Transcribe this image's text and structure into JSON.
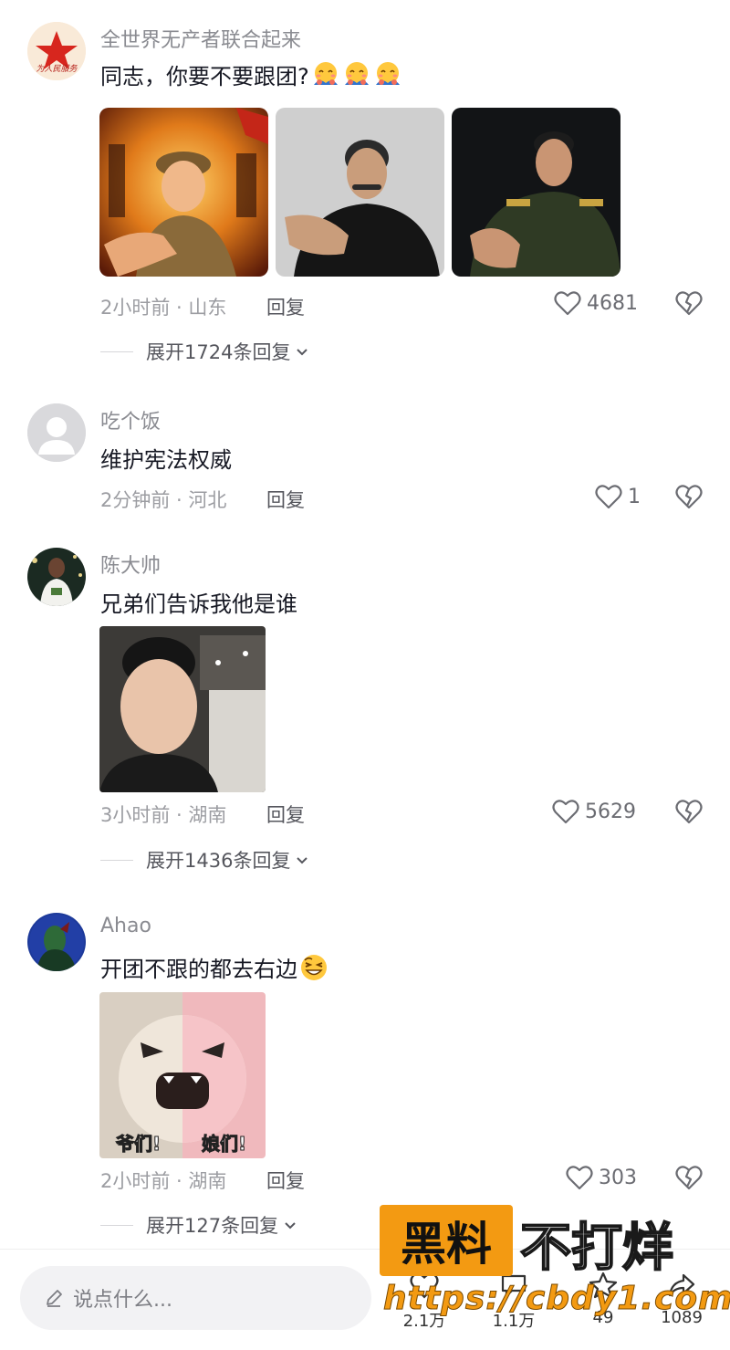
{
  "comments": [
    {
      "username": "全世界无产者联合起来",
      "text": "同志，你要不要跟团?",
      "avatar_caption": "为人民服务",
      "time_location": "2小时前 · 山东",
      "reply_label": "回复",
      "likes": "4681",
      "expand_label": "展开1724条回复",
      "images": [
        "revolutionary-soldier-reaching-hand",
        "man-in-black-robe-reaching-hand",
        "military-officer-reaching-hand"
      ]
    },
    {
      "username": "吃个饭",
      "text": "维护宪法权威",
      "time_location": "2分钟前 · 河北",
      "reply_label": "回复",
      "likes": "1"
    },
    {
      "username": "陈大帅",
      "text": "兄弟们告诉我他是谁",
      "time_location": "3小时前 · 湖南",
      "reply_label": "回复",
      "likes": "5629",
      "expand_label": "展开1436条回复",
      "images": [
        "young-man-selfie"
      ]
    },
    {
      "username": "Ahao",
      "text": "开团不跟的都去右边",
      "time_location": "2小时前 · 湖南",
      "reply_label": "回复",
      "likes": "303",
      "expand_label": "展开127条回复",
      "images": [
        "angry-cat-meme"
      ],
      "meme_left_caption": "爷们!",
      "meme_right_caption": "娘们!"
    }
  ],
  "bottom_bar": {
    "input_placeholder": "说点什么...",
    "counts": [
      "2.1万",
      "1.1万",
      "49",
      "1089"
    ]
  },
  "watermark": {
    "box_text": "黑料",
    "right_text": "不打烊",
    "url": "https://cbdy1.com"
  },
  "colors": {
    "accent_red": "#d7261e",
    "watermark_orange": "#f39a12"
  }
}
